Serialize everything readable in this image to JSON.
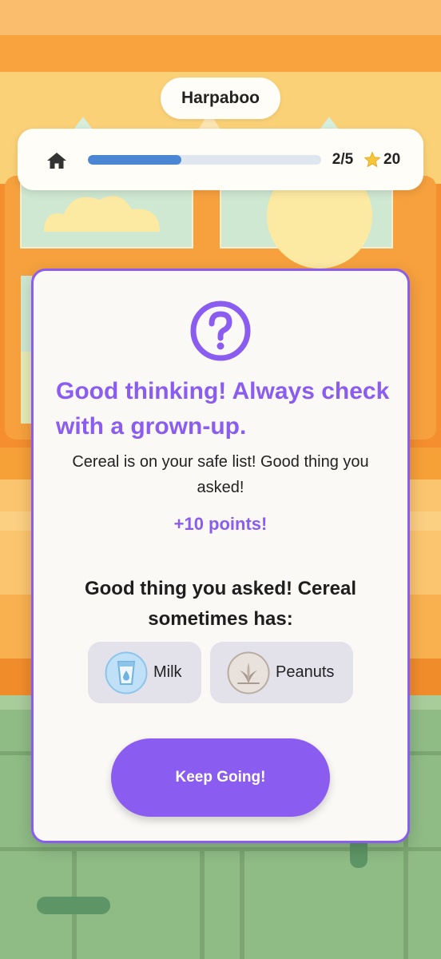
{
  "character": {
    "name": "Harpaboo"
  },
  "hud": {
    "home_icon": "home-icon",
    "progress_current": 2,
    "progress_total": 5,
    "progress_fraction": 0.4,
    "progress_text": "2/5",
    "score_icon": "star-icon",
    "score": "20"
  },
  "dialog": {
    "icon": "question-circle-icon",
    "headline": "Good thinking! Always check with a grown-up.",
    "subtext": "Cereal is on your safe list! Good thing you asked!",
    "points": "+10 points!",
    "allergen_intro": "Good thing you asked! Cereal sometimes has:",
    "allergens": [
      {
        "label": "Milk",
        "icon": "milk-glass-icon"
      },
      {
        "label": "Peanuts",
        "icon": "peanut-icon"
      }
    ],
    "cta_label": "Keep Going!"
  },
  "colors": {
    "accent": "#8a5cf0",
    "progress": "#4a86d4",
    "background_orange": "#f7a63a",
    "floor_green": "#8fbb85"
  }
}
